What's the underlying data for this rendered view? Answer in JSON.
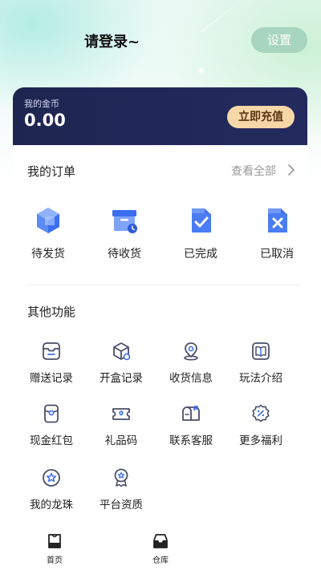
{
  "header": {
    "login_prompt": "请登录~",
    "settings_label": "设置"
  },
  "wallet": {
    "label": "我的金币",
    "value": "0.00",
    "recharge_label": "立即充值"
  },
  "orders": {
    "title": "我的订单",
    "view_all_label": "查看全部",
    "items": [
      {
        "label": "待发货",
        "icon": "cube-icon"
      },
      {
        "label": "待收货",
        "icon": "box-clock-icon"
      },
      {
        "label": "已完成",
        "icon": "check-doc-icon"
      },
      {
        "label": "已取消",
        "icon": "cancel-doc-icon"
      }
    ]
  },
  "functions": {
    "title": "其他功能",
    "items": [
      {
        "label": "赠送记录",
        "icon": "gift-record-icon"
      },
      {
        "label": "开盒记录",
        "icon": "open-box-icon"
      },
      {
        "label": "收货信息",
        "icon": "location-pin-icon"
      },
      {
        "label": "玩法介绍",
        "icon": "book-icon"
      },
      {
        "label": "现金红包",
        "icon": "red-packet-icon"
      },
      {
        "label": "礼品码",
        "icon": "ticket-icon"
      },
      {
        "label": "联系客服",
        "icon": "mailbox-icon"
      },
      {
        "label": "更多福利",
        "icon": "percent-badge-icon"
      },
      {
        "label": "我的龙珠",
        "icon": "star-circle-icon"
      },
      {
        "label": "平台资质",
        "icon": "medal-icon"
      }
    ]
  },
  "tabbar": {
    "items": [
      {
        "label": "首页",
        "icon": "home-bag-icon"
      },
      {
        "label": "仓库",
        "icon": "warehouse-icon"
      }
    ]
  },
  "colors": {
    "card_bg": "#1e2550",
    "recharge_bg": "#f6d7a7",
    "settings_bg": "#a8d5bf",
    "icon_blue": "#3b6df0",
    "icon_line": "#4a4f6a"
  }
}
